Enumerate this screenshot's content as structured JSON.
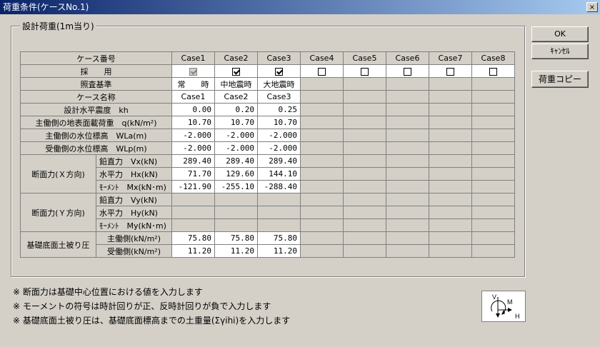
{
  "window": {
    "title": "荷重条件(ケースNo.1)",
    "close_label": "×"
  },
  "group": {
    "label": "設計荷重(1m当り)"
  },
  "buttons": {
    "ok": "OK",
    "cancel": "ｷｬﾝｾﾙ",
    "copy": "荷重コピー"
  },
  "table": {
    "header_label": "ケース番号",
    "cases": [
      "Case1",
      "Case2",
      "Case3",
      "Case4",
      "Case5",
      "Case6",
      "Case7",
      "Case8"
    ],
    "adopt_label": "採　　用",
    "adopt": [
      true,
      true,
      true,
      false,
      false,
      false,
      false,
      false
    ],
    "basis_label": "照査基準",
    "basis": [
      "常　　時",
      "中地震時",
      "大地震時",
      "",
      "",
      "",
      "",
      ""
    ],
    "name_label": "ケース名称",
    "names": [
      "Case1",
      "Case2",
      "Case3",
      "",
      "",
      "",
      "",
      ""
    ],
    "kh_label": "設計水平震度　kh",
    "kh": [
      "0.00",
      "0.20",
      "0.25",
      "",
      "",
      "",
      "",
      ""
    ],
    "q_label": "主働側の地表面載荷重　q(kN/m²)",
    "q": [
      "10.70",
      "10.70",
      "10.70",
      "",
      "",
      "",
      "",
      ""
    ],
    "wla_label": "主働側の水位標高　WLa(m)",
    "wla": [
      "-2.000",
      "-2.000",
      "-2.000",
      "",
      "",
      "",
      "",
      ""
    ],
    "wlp_label": "受働側の水位標高　WLp(m)",
    "wlp": [
      "-2.000",
      "-2.000",
      "-2.000",
      "",
      "",
      "",
      "",
      ""
    ],
    "sec_x_label": "断面力(Ｘ方向)",
    "vx_label": "鉛直力　Vx(kN)",
    "vx": [
      "289.40",
      "289.40",
      "289.40",
      "",
      "",
      "",
      "",
      ""
    ],
    "hx_label": "水平力　Hx(kN)",
    "hx": [
      "71.70",
      "129.60",
      "144.10",
      "",
      "",
      "",
      "",
      ""
    ],
    "mx_label": "ﾓｰﾒﾝﾄ　Mx(kN･m)",
    "mx": [
      "-121.90",
      "-255.10",
      "-288.40",
      "",
      "",
      "",
      "",
      ""
    ],
    "sec_y_label": "断面力(Ｙ方向)",
    "vy_label": "鉛直力　Vy(kN)",
    "hy_label": "水平力　Hy(kN)",
    "my_label": "ﾓｰﾒﾝﾄ　My(kN･m)",
    "soil_label": "基礎底面土被り圧",
    "active_label": "主働側(kN/m²)",
    "active": [
      "75.80",
      "75.80",
      "75.80",
      "",
      "",
      "",
      "",
      ""
    ],
    "passive_label": "受働側(kN/m²)",
    "passive": [
      "11.20",
      "11.20",
      "11.20",
      "",
      "",
      "",
      "",
      ""
    ]
  },
  "notes": [
    "※ 断面力は基礎中心位置における値を入力します",
    "※ モーメントの符号は時計回りが正、反時計回りが負で入力します",
    "※ 基礎底面土被り圧は、基礎底面標高までの土重量(Σγihi)を入力します"
  ],
  "axis_diagram": {
    "v": "V",
    "m": "M",
    "h": "H"
  }
}
